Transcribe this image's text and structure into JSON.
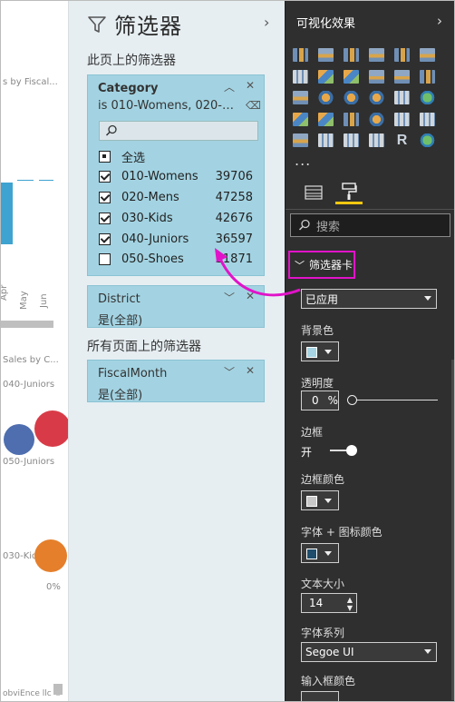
{
  "canvas": {
    "fragment_1": "s by Fiscal...",
    "axis_labels": [
      "Apr",
      "May",
      "Jun"
    ],
    "fragment_2": "Sales by C...",
    "fragment_3": "040-Juniors",
    "fragment_4": "050-Juniors",
    "fragment_5": "030-Kids",
    "pct_label": "0%",
    "footer": "obviEnce llc ©"
  },
  "filter_pane": {
    "title": "筛选器",
    "page_filters_label": "此页上的筛选器",
    "all_pages_label": "所有页面上的筛选器",
    "category": {
      "title": "Category",
      "summary": "is 010-Womens, 020-M...",
      "items": [
        {
          "label": "全选",
          "count": "",
          "state": "partial"
        },
        {
          "label": "010-Womens",
          "count": "39706",
          "state": "checked"
        },
        {
          "label": "020-Mens",
          "count": "47258",
          "state": "checked"
        },
        {
          "label": "030-Kids",
          "count": "42676",
          "state": "checked"
        },
        {
          "label": "040-Juniors",
          "count": "36597",
          "state": "checked"
        },
        {
          "label": "050-Shoes",
          "count": "21871",
          "state": "unchecked"
        }
      ]
    },
    "district": {
      "title": "District",
      "summary": "是(全部)"
    },
    "fiscalmonth": {
      "title": "FiscalMonth",
      "summary": "是(全部)"
    }
  },
  "viz_pane": {
    "title": "可视化效果",
    "icon_r_label": "R",
    "ellipsis": "...",
    "search_placeholder": "搜索",
    "section": "筛选器卡",
    "state_value": "已应用",
    "background_label": "背景色",
    "background_color": "#a6d4e3",
    "transparency_label": "透明度",
    "transparency_value": "0",
    "transparency_unit": "%",
    "border_label": "边框",
    "border_toggle": "开",
    "border_color_label": "边框颜色",
    "border_color": "#c8c8c8",
    "font_icon_color_label": "字体 + 图标颜色",
    "font_icon_color": "#1f4d6b",
    "text_size_label": "文本大小",
    "text_size_value": "14",
    "font_family_label": "字体系列",
    "font_family_value": "Segoe UI",
    "input_border_color_label": "输入框颜色"
  }
}
